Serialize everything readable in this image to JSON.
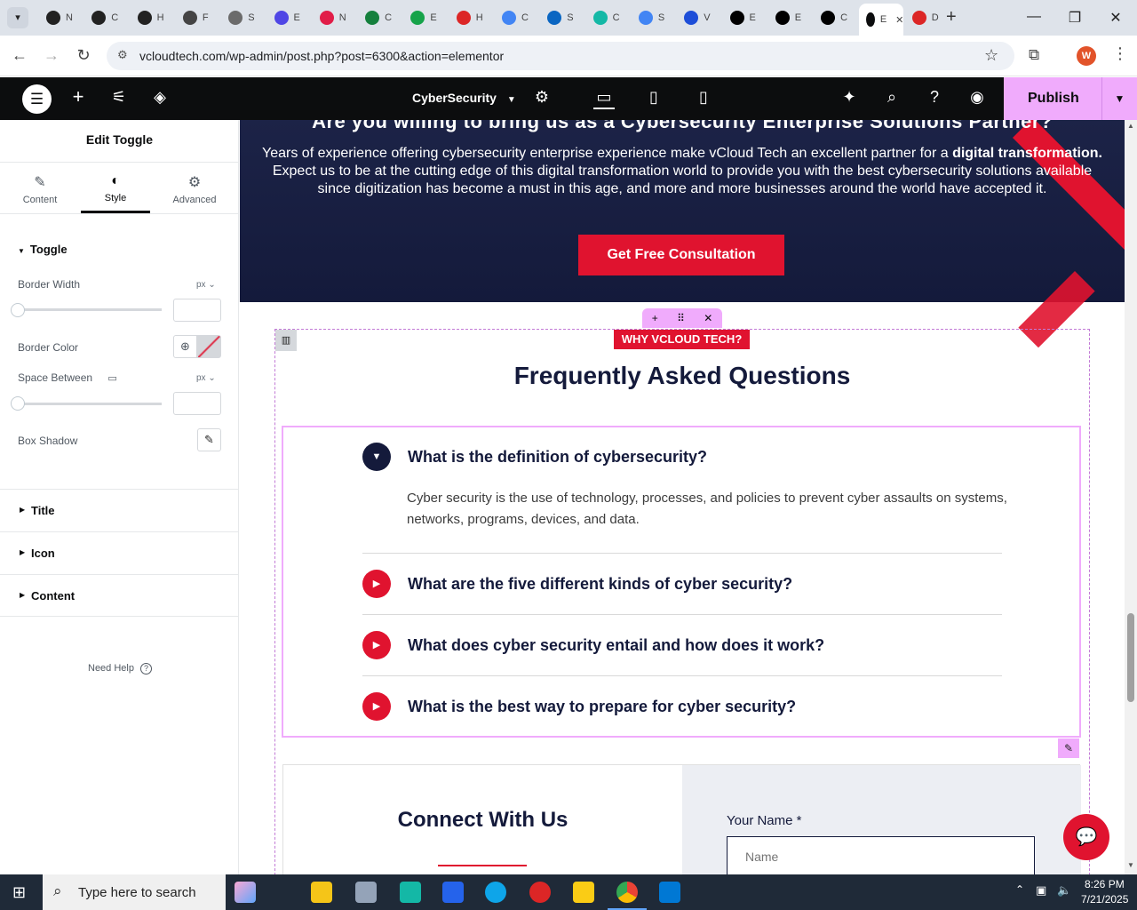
{
  "browser": {
    "url": "vcloudtech.com/wp-admin/post.php?post=6300&action=elementor",
    "tabs": [
      {
        "label": "N",
        "color": "#222222"
      },
      {
        "label": "C",
        "color": "#222222"
      },
      {
        "label": "H",
        "color": "#222222"
      },
      {
        "label": "F",
        "color": "#444444"
      },
      {
        "label": "S",
        "color": "#6b6b6b"
      },
      {
        "label": "E",
        "color": "#4f46e5"
      },
      {
        "label": "N",
        "color": "#e11d48"
      },
      {
        "label": "C",
        "color": "#15803d"
      },
      {
        "label": "E",
        "color": "#16a34a"
      },
      {
        "label": "H",
        "color": "#dc2626"
      },
      {
        "label": "C",
        "color": "#4285f4"
      },
      {
        "label": "S",
        "color": "#0a66c2"
      },
      {
        "label": "C",
        "color": "#14b8a6"
      },
      {
        "label": "S",
        "color": "#4285f4"
      },
      {
        "label": "V",
        "color": "#1d4ed8"
      },
      {
        "label": "E",
        "color": "#000000"
      },
      {
        "label": "E",
        "color": "#000000"
      },
      {
        "label": "C",
        "color": "#000000"
      },
      {
        "label": "E",
        "color": "#0c0d0e"
      },
      {
        "label": "D",
        "color": "#dc2626"
      }
    ],
    "profile_initial": "W"
  },
  "elementor": {
    "page_name": "CyberSecurity",
    "publish_label": "Publish"
  },
  "panel": {
    "title": "Edit Toggle",
    "tabs": {
      "content": "Content",
      "style": "Style",
      "advanced": "Advanced"
    },
    "section_toggle": "Toggle",
    "border_width": "Border Width",
    "border_color": "Border Color",
    "space_between": "Space Between",
    "box_shadow": "Box Shadow",
    "unit": "px",
    "sections": [
      "Title",
      "Icon",
      "Content"
    ],
    "need_help": "Need Help"
  },
  "hero": {
    "heading": "Are you willing to bring us as a Cybersecurity Enterprise Solutions Partner?",
    "body_pre": "Years of experience offering cybersecurity enterprise experience make vCloud Tech an excellent partner for a ",
    "body_bold": "digital transformation.",
    "body_post": " Expect us to be at the cutting edge of this digital transformation world to provide you with the best cybersecurity solutions available since digitization has become a must in this age, and more and more businesses around the world have accepted it.",
    "cta": "Get Free Consultation"
  },
  "faq": {
    "badge": "WHY VCLOUD TECH?",
    "title": "Frequently Asked Questions",
    "items": [
      {
        "q": "What is the definition of cybersecurity?",
        "open": true
      },
      {
        "q": "What are the five different kinds of cyber security?",
        "open": false
      },
      {
        "q": "What does cyber security entail and how does it work?",
        "open": false
      },
      {
        "q": "What is the best way to prepare for cyber security?",
        "open": false
      }
    ],
    "answer": "Cyber security is the use of technology, processes, and policies to prevent cyber assaults on systems, networks, programs, devices, and data."
  },
  "contact": {
    "title": "Connect With Us",
    "name_label": "Your Name *",
    "name_placeholder": "Name"
  },
  "taskbar": {
    "search_placeholder": "Type here to search",
    "time": "8:26 PM",
    "date": "7/21/2025"
  },
  "colors": {
    "accent": "#e0132f",
    "navy": "#141a3b",
    "elementor_pink": "#f0abfc"
  }
}
